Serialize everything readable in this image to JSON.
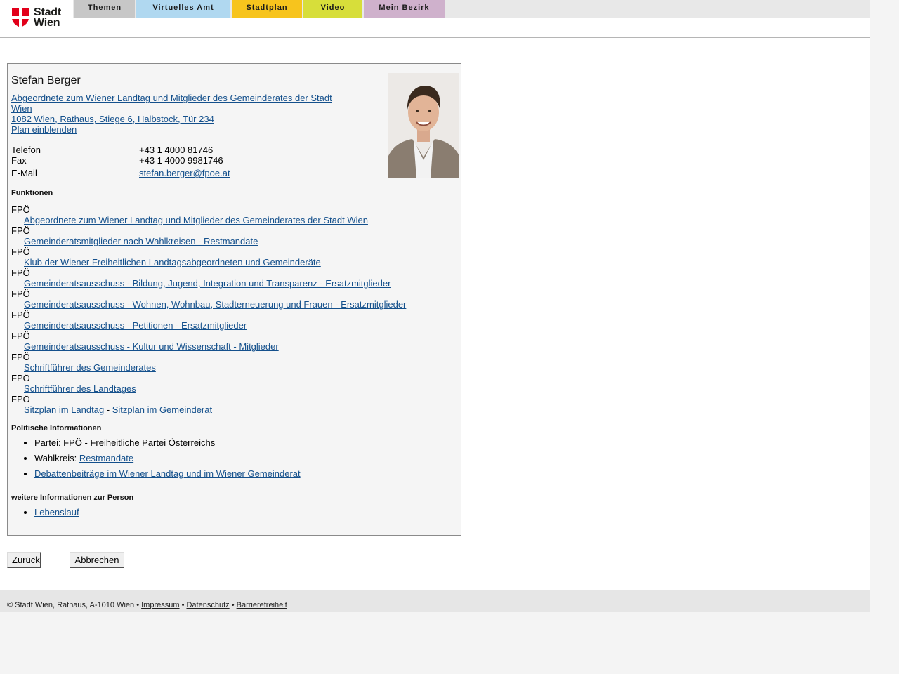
{
  "logo": {
    "line1": "Stadt",
    "line2": "Wien"
  },
  "nav": {
    "tabs": [
      {
        "label": "Themen",
        "color": "#c7c7c7"
      },
      {
        "label": "Virtuelles Amt",
        "color": "#b0d8f0"
      },
      {
        "label": "Stadtplan",
        "color": "#f7c41d"
      },
      {
        "label": "Video",
        "color": "#d7de3a"
      },
      {
        "label": "Mein Bezirk",
        "color": "#cfb1cc"
      }
    ]
  },
  "person": {
    "name": "Stefan Berger",
    "role_link": "Abgeordnete zum Wiener Landtag und Mitglieder des Gemeinderates der Stadt Wien ",
    "address_link": "1082 Wien, Rathaus, Stiege 6, Halbstock, Tür 234",
    "plan_link": "Plan einblenden",
    "contact": {
      "phone_label": "Telefon",
      "phone_value": "+43 1 4000 81746",
      "fax_label": "Fax",
      "fax_value": "+43 1 4000 9981746",
      "email_label": "E-Mail",
      "email_value": "stefan.berger@fpoe.at"
    }
  },
  "functions": {
    "heading": "Funktionen",
    "items": [
      {
        "party": "FPÖ",
        "link": "Abgeordnete zum Wiener Landtag und Mitglieder des Gemeinderates der Stadt Wien"
      },
      {
        "party": "FPÖ",
        "link": "Gemeinderatsmitglieder nach Wahlkreisen - Restmandate"
      },
      {
        "party": "FPÖ",
        "link": "Klub der Wiener Freiheitlichen Landtagsabgeordneten und Gemeinderäte"
      },
      {
        "party": "FPÖ",
        "link": "Gemeinderatsausschuss - Bildung, Jugend, Integration und Transparenz - Ersatzmitglieder"
      },
      {
        "party": "FPÖ",
        "link": "Gemeinderatsausschuss - Wohnen, Wohnbau, Stadterneuerung und Frauen - Ersatzmitglieder"
      },
      {
        "party": "FPÖ",
        "link": "Gemeinderatsausschuss - Petitionen - Ersatzmitglieder"
      },
      {
        "party": "FPÖ",
        "link": "Gemeinderatsausschuss - Kultur und Wissenschaft - Mitglieder"
      },
      {
        "party": "FPÖ",
        "link": "Schriftführer des Gemeinderates"
      },
      {
        "party": "FPÖ",
        "link": "Schriftführer des Landtages"
      }
    ],
    "last_party": "FPÖ",
    "seat_link_1": "Sitzplan im Landtag",
    "seat_sep": " - ",
    "seat_link_2": "Sitzplan im Gemeinderat"
  },
  "political": {
    "heading": "Politische Informationen",
    "party_text": "Partei: FPÖ - Freiheitliche Partei Österreichs",
    "constituency_label": "Wahlkreis: ",
    "constituency_link": "Restmandate",
    "debates_link": "Debattenbeiträge im Wiener Landtag und im Wiener Gemeinderat"
  },
  "more": {
    "heading": "weitere Informationen zur Person",
    "cv_link": "Lebenslauf"
  },
  "buttons": {
    "back": "Zurück",
    "cancel": "Abbrechen"
  },
  "footer": {
    "copyright": "© Stadt Wien, Rathaus, A-1010 Wien • ",
    "impressum": "Impressum",
    "sep1": " • ",
    "datenschutz": "Datenschutz",
    "sep2": " • ",
    "barrierefreiheit": "Barrierefreiheit"
  }
}
